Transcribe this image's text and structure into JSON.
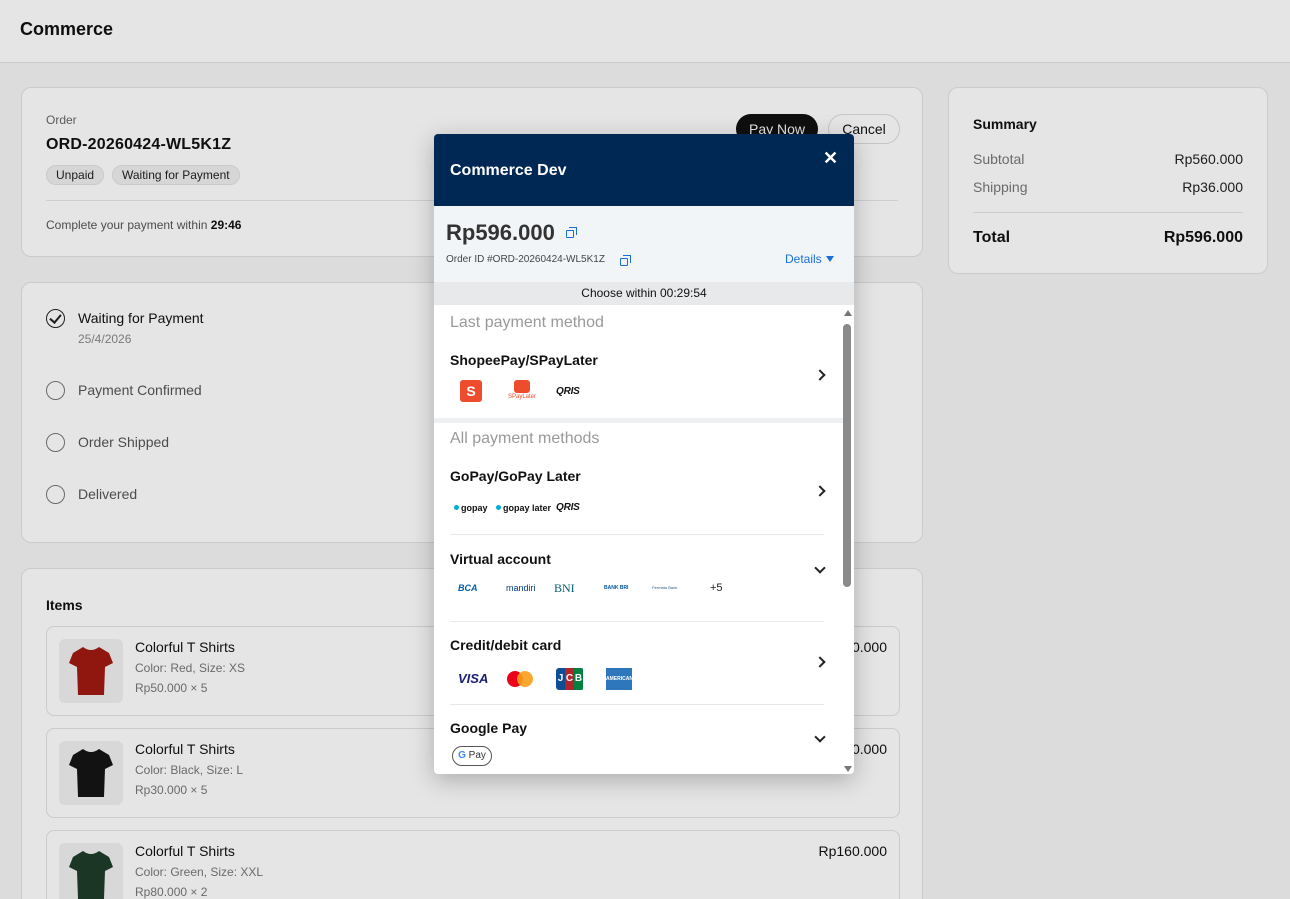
{
  "app": {
    "title": "Commerce"
  },
  "order": {
    "label": "Order",
    "id": "ORD-20260424-WL5K1Z",
    "badges": [
      "Unpaid",
      "Waiting for Payment"
    ],
    "pay_now": "Pay Now",
    "cancel": "Cancel",
    "within_text": "Complete your payment within",
    "within_time": "29:46"
  },
  "status": {
    "steps": [
      {
        "name": "Waiting for Payment",
        "date": "25/4/2026"
      },
      {
        "name": "Payment Confirmed"
      },
      {
        "name": "Order Shipped"
      },
      {
        "name": "Delivered"
      }
    ]
  },
  "items": {
    "title": "Items",
    "list": [
      {
        "name": "Colorful T Shirts",
        "meta": "Color: Red, Size: XS",
        "qty": "Rp50.000 × 5",
        "price": "Rp250.000",
        "color": "#a11a12"
      },
      {
        "name": "Colorful T Shirts",
        "meta": "Color: Black, Size: L",
        "qty": "Rp30.000 × 5",
        "price": "Rp150.000",
        "color": "#151515"
      },
      {
        "name": "Colorful T Shirts",
        "meta": "Color: Green, Size: XXL",
        "qty": "Rp80.000 × 2",
        "price": "Rp160.000",
        "color": "#1f3d2a"
      }
    ]
  },
  "summary": {
    "title": "Summary",
    "subtotal_label": "Subtotal",
    "subtotal": "Rp560.000",
    "shipping_label": "Shipping",
    "shipping": "Rp36.000",
    "total_label": "Total",
    "total": "Rp596.000"
  },
  "payment_modal": {
    "title": "Commerce Dev",
    "close": "✕",
    "amount": "Rp596.000",
    "order_id": "Order ID #ORD-20260424-WL5K1Z",
    "details": "Details",
    "choose_within": "Choose within 00:29:54",
    "last_title": "Last payment method",
    "all_title": "All payment methods",
    "methods": {
      "shopeepay": {
        "name": "ShopeePay/SPayLater",
        "spaylater_text": "SPayLater",
        "qris": "QRIS"
      },
      "gopay": {
        "name": "GoPay/GoPay Later",
        "gopay": "gopay",
        "gopay_later": "gopay later",
        "qris": "QRIS"
      },
      "virtual": {
        "name": "Virtual account",
        "banks": [
          "BCA",
          "mandiri",
          "BNI",
          "BANK BRI",
          "Permata Bank"
        ],
        "more": "+5"
      },
      "card": {
        "name": "Credit/debit card",
        "visa": "VISA",
        "jcb": [
          "J",
          "C",
          "B"
        ],
        "amex": "AMERICAN EXPRESS"
      },
      "gpay": {
        "name": "Google Pay",
        "g": "G",
        "pay": "Pay"
      }
    }
  },
  "colors": {
    "modal_header": "#002855",
    "link": "#1a6ed8",
    "shopee": "#ee4d2d"
  }
}
